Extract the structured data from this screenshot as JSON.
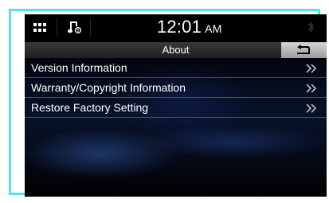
{
  "status_bar": {
    "apps_icon": "grid-icon",
    "music_icon": "music-note-icon",
    "time": "12:01",
    "ampm": "AM",
    "bluetooth_icon": "bluetooth-icon"
  },
  "title_bar": {
    "title": "About",
    "back_icon": "back-arrow-icon"
  },
  "menu": {
    "items": [
      {
        "label": "Version Information",
        "icon": "double-chevron-right-icon"
      },
      {
        "label": "Warranty/Copyright Information",
        "icon": "double-chevron-right-icon"
      },
      {
        "label": "Restore Factory Setting",
        "icon": "double-chevron-right-icon"
      }
    ]
  },
  "colors": {
    "frame_border": "#57e1e8",
    "screen_bg": "#000000",
    "divider": "#4a4d5a",
    "back_button": "#bdbdbd"
  }
}
